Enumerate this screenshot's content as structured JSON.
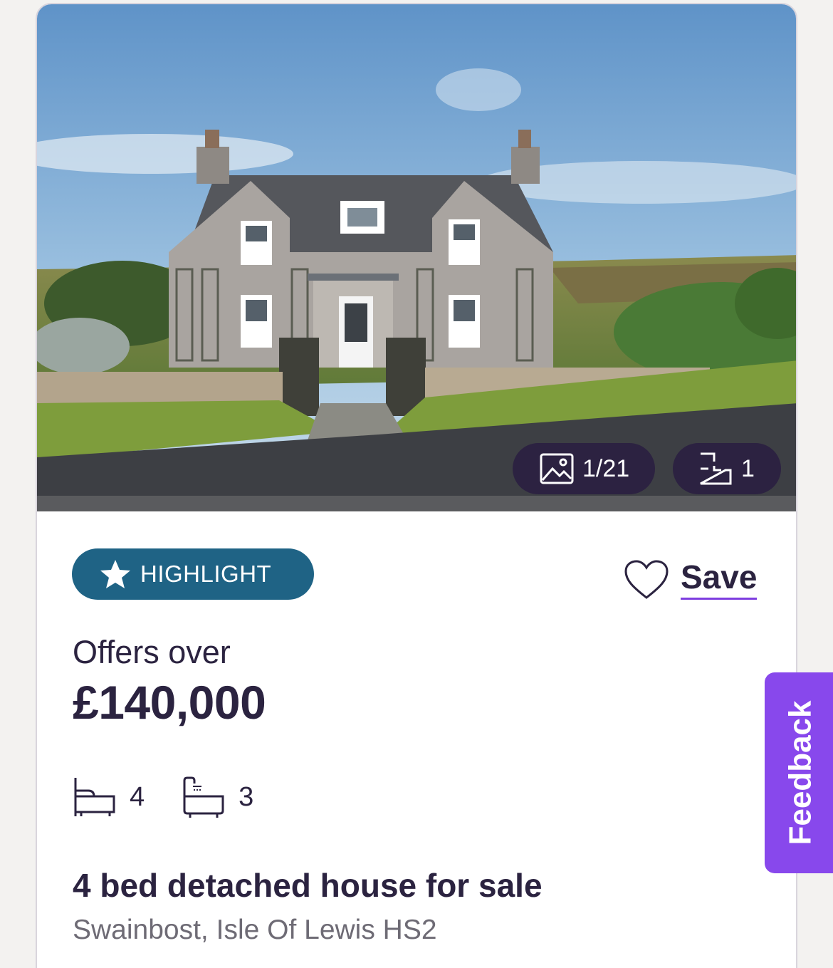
{
  "listing": {
    "photo": {
      "image_counter": "1/21",
      "floorplan_count": "1"
    },
    "highlight_label": "HIGHLIGHT",
    "save_label": "Save",
    "price_qualifier": "Offers over",
    "price": "£140,000",
    "bedrooms": "4",
    "bathrooms": "3",
    "title": "4 bed detached house for sale",
    "address": "Swainbost, Isle Of Lewis HS2"
  },
  "feedback_label": "Feedback",
  "colors": {
    "badge_dark": "#2c2241",
    "highlight_blue": "#1f6385",
    "accent_purple": "#8848ec",
    "text_primary": "#2b2340",
    "text_secondary": "#6e6b75"
  },
  "icons": {
    "image_counter": "image-icon",
    "floorplan": "floorplan-icon",
    "highlight": "star-icon",
    "save": "heart-icon",
    "bedrooms": "bed-icon",
    "bathrooms": "bath-icon"
  }
}
